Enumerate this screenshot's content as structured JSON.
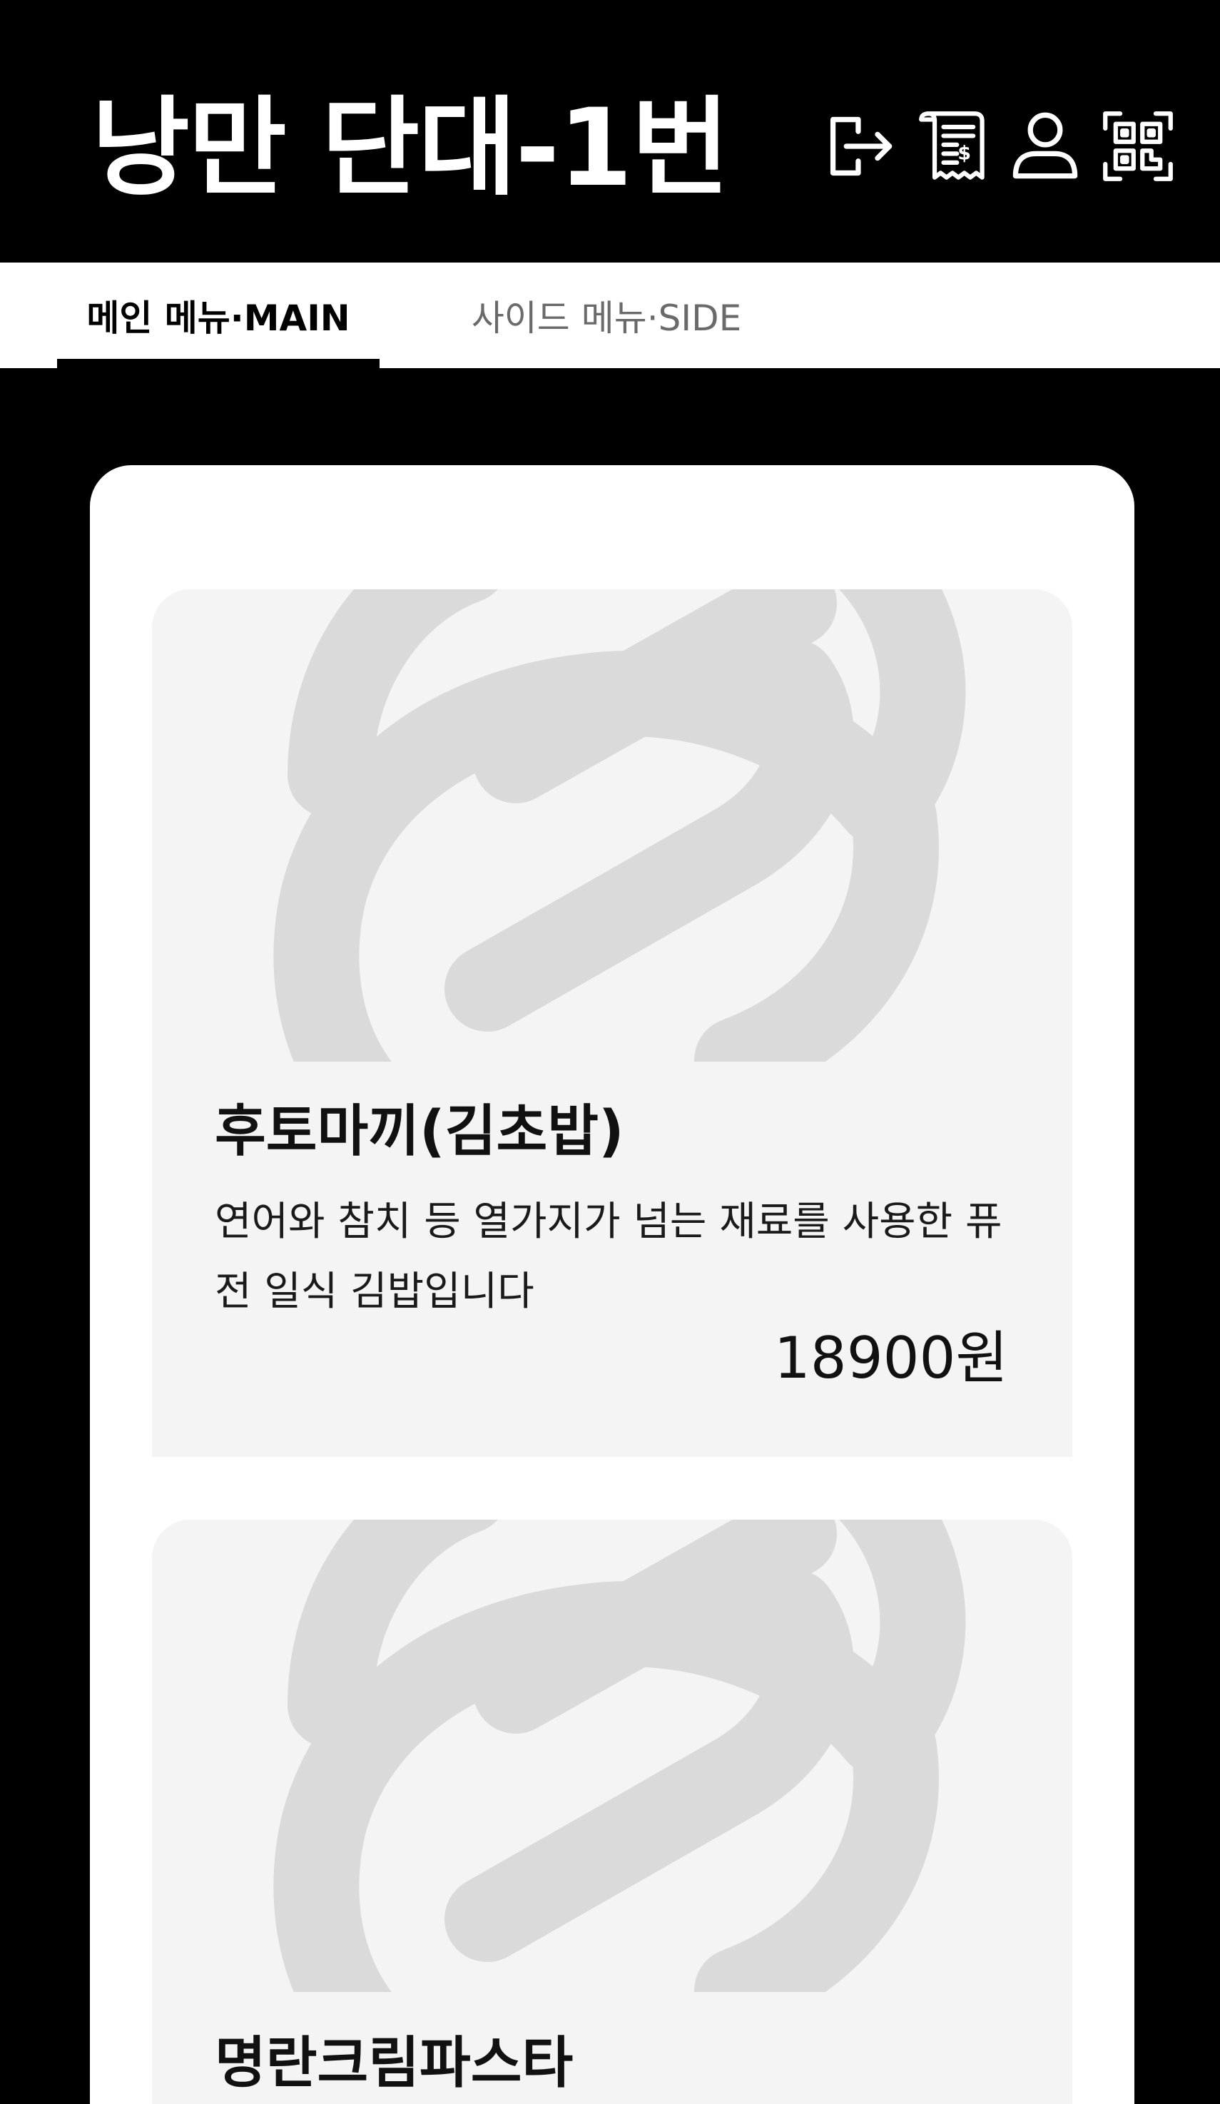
{
  "header": {
    "title": "낭만 단대-1번",
    "icons": [
      "logout-icon",
      "receipt-icon",
      "user-icon",
      "qr-code-icon"
    ]
  },
  "tabs": [
    {
      "label": "메인 메뉴·MAIN",
      "active": true
    },
    {
      "label": "사이드 메뉴·SIDE",
      "active": false
    }
  ],
  "menu_items": [
    {
      "name": "후토마끼(김초밥)",
      "description": "연어와 참치 등 열가지가 넘는 재료를 사용한 퓨전 일식 김밥입니다",
      "price": "18900원",
      "image_icon": "placeholder-logo-icon"
    },
    {
      "name": "명란크림파스타",
      "image_icon": "placeholder-logo-icon"
    }
  ],
  "colors": {
    "background": "#000000",
    "surface": "#ffffff",
    "item_background": "#f4f4f4",
    "placeholder_logo": "#dadada",
    "inactive_tab": "#6a6a6a"
  }
}
